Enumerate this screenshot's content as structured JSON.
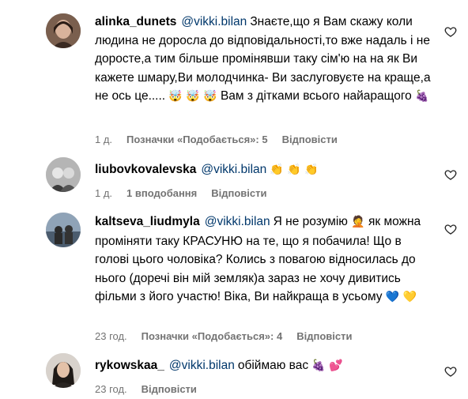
{
  "comments": [
    {
      "username": "alinka_dunets",
      "mention": "@vikki.bilan",
      "text": "Знаєте,що я Вам скажу коли людина не доросла до відповідальності,то вже надаль і не дорoсте,а тим більше проміняв­ши таку сім'ю на на як Ви кажете шмару,Ви молодчинка- Ви заслуговуєте на краще,а не ось це.....",
      "emojis": "🤯 🤯 🤯",
      "text2": "Вам з дітками всього найаращого",
      "emojis2": "🍇",
      "time": "1 д.",
      "likes": "Позначки «Подобається»: 5",
      "reply": "Відповісти"
    },
    {
      "username": "liubovkovalevska",
      "mention": "@vikki.bilan",
      "text": "",
      "emojis": "👏 👏 👏",
      "time": "1 д.",
      "likes": "1 вподобання",
      "reply": "Відповісти"
    },
    {
      "username": "kaltseva_liudmyla",
      "mention": "@vikki.bilan",
      "text": "Я не розумію",
      "emojis": "🤦",
      "text2": "як можна проміняти таку КРАСУНЮ на те, що я побачила! Що в голові цього чоловіка? Колись з повагою відносилась до нього (доречі він мій земляк)а зараз не хочу дивитись фільми з його участю! Віка, Ви найкраща в усьому",
      "emojis2": "💙 💛",
      "time": "23 год.",
      "likes": "Позначки «Подобається»: 4",
      "reply": "Відповісти"
    },
    {
      "username": "rykowskaa_",
      "mention": "@vikki.bilan",
      "text": "обіймаю вас",
      "emojis": "🍇 💕",
      "time": "23 год.",
      "reply": "Відповісти"
    }
  ],
  "colors": {
    "mention": "#00376b",
    "meta": "#737373"
  },
  "icons": {
    "like": "heart-icon"
  }
}
